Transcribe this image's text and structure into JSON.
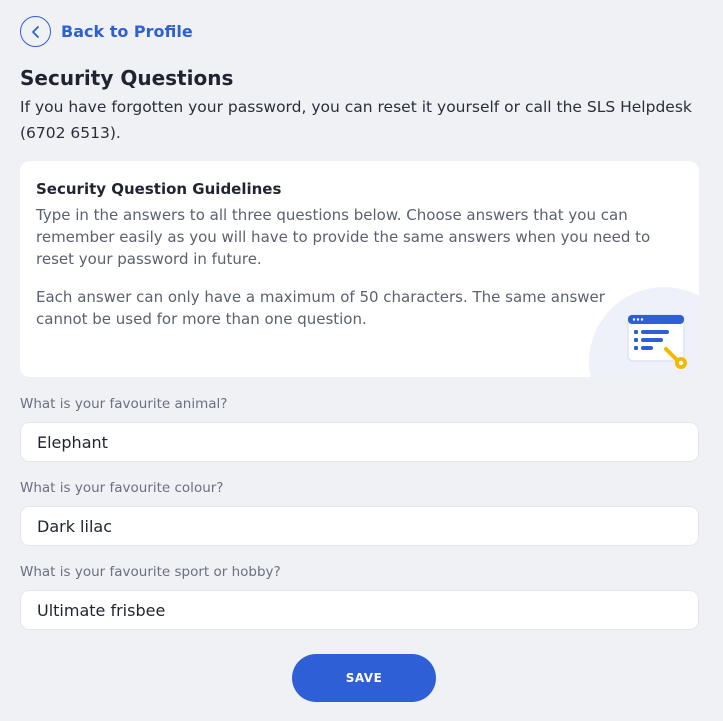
{
  "nav": {
    "back_label": "Back to Profile",
    "back_icon": "chevron-left-icon"
  },
  "page": {
    "title": "Security Questions",
    "description": "If you have forgotten your password, you can reset it yourself or call the SLS Helpdesk (6702 6513)."
  },
  "guidelines": {
    "title": "Security Question Guidelines",
    "paragraph1": "Type in the answers to all three questions below. Choose answers that you can remember easily as you will have to provide the same answers when you need to reset your password in future.",
    "paragraph2": "Each answer can only have a maximum of 50 characters. The same answer cannot be used for more than one question.",
    "illustration_icon": "security-checklist-key-icon"
  },
  "questions": [
    {
      "label": "What is your favourite animal?",
      "answer": "Elephant"
    },
    {
      "label": "What is your favourite colour?",
      "answer": "Dark lilac"
    },
    {
      "label": "What is your favourite sport or hobby?",
      "answer": "Ultimate frisbee"
    }
  ],
  "actions": {
    "save_label": "SAVE"
  },
  "colors": {
    "accent": "#2f5fd6",
    "background": "#f0f1f5",
    "card": "#ffffff",
    "key": "#f5b800"
  }
}
